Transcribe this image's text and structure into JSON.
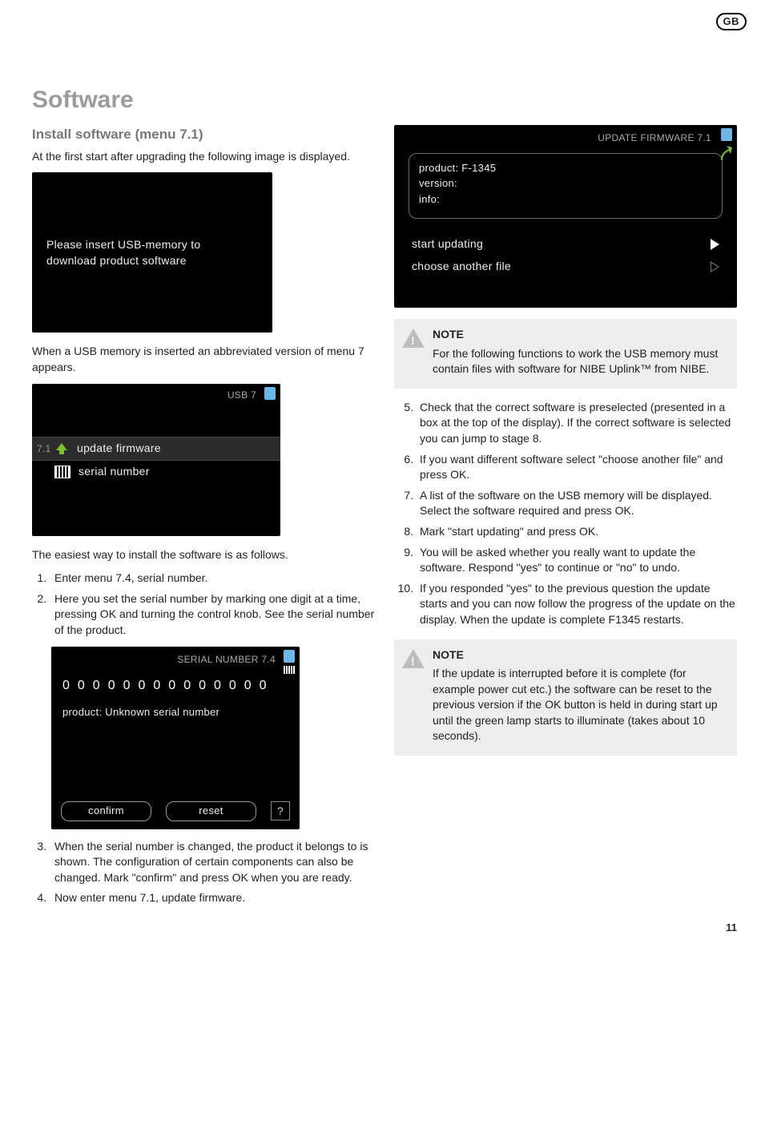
{
  "region_badge": "GB",
  "heading": "Software",
  "subheading": "Install software (menu 7.1)",
  "intro": "At the first start after upgrading the following image is displayed.",
  "screen_insert": {
    "line1": "Please insert USB-memory to",
    "line2": "download product software"
  },
  "after_insert_text": "When a USB memory is inserted an abbreviated version of menu 7 appears.",
  "screen_usb7": {
    "title": "USB 7",
    "row1_num": "7.1",
    "row1_label": "update firmware",
    "row2_label": "serial number"
  },
  "easiest_intro": "The easiest way to install the software is as follows.",
  "left_steps": {
    "s1": "Enter menu 7.4, serial number.",
    "s2": "Here you set the serial number by marking one digit at a time, pressing OK and turning the control knob. See the serial number of the product.",
    "s3": "When the serial number is changed, the product it belongs to is shown. The configuration of certain components can also be changed. Mark \"confirm\" and press OK when you are ready.",
    "s4": "Now enter menu 7.1, update firmware."
  },
  "screen_serial": {
    "title": "SERIAL NUMBER 7.4",
    "digits": "00000000000000",
    "product_line": "product: Unknown serial number",
    "confirm": "confirm",
    "reset": "reset",
    "help": "?"
  },
  "screen_update": {
    "title": "UPDATE FIRMWARE 7.1",
    "product_line": "product: F-1345",
    "version_line": "version:",
    "info_line": "info:",
    "action_start": "start updating",
    "action_choose": "choose another file"
  },
  "note1": {
    "title": "NOTE",
    "body": "For the following functions to work the USB memory must contain files with software for NIBE Uplink™ from NIBE."
  },
  "right_steps": {
    "s5": "Check that the correct software is preselected (presented in a box at the top of the display). If the correct software is selected you can jump to stage 8.",
    "s6": "If you want different software select \"choose another file\" and press OK.",
    "s7": "A list of the software on the USB memory will be displayed. Select the software required and press OK.",
    "s8": "Mark \"start updating\" and press OK.",
    "s9": "You will be asked whether you really want to update the software. Respond \"yes\" to continue or \"no\" to undo.",
    "s10": "If you responded \"yes\" to the previous question the update starts and you can now follow the progress of the update on the display. When the update is complete F1345 restarts."
  },
  "note2": {
    "title": "NOTE",
    "body": "If the update is interrupted before it is complete (for example power cut etc.) the software can be reset to the previous version if the OK button is held in during start up until the green lamp starts to illuminate (takes about 10 seconds)."
  },
  "page_number": "11"
}
